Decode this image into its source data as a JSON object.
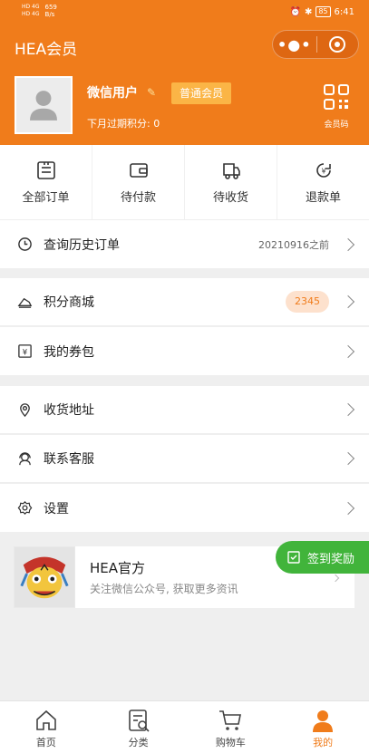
{
  "status_bar": {
    "network_1": "HD 4G",
    "network_2": "HD 4G",
    "speed_value": "659",
    "speed_unit": "B/s",
    "battery": "85",
    "time": "6:41"
  },
  "nav": {
    "title": "HEA会员",
    "more_glyph": "•●•"
  },
  "profile": {
    "username": "微信用户",
    "badge": "普通会员",
    "points_label": "下月过期积分: 0",
    "qr_label": "会员码"
  },
  "orders": [
    {
      "label": "全部订单",
      "icon": "order-list-icon"
    },
    {
      "label": "待付款",
      "icon": "wallet-icon"
    },
    {
      "label": "待收货",
      "icon": "delivery-truck-icon"
    },
    {
      "label": "退款单",
      "icon": "refund-icon"
    }
  ],
  "history": {
    "label": "查询历史订单",
    "date": "20210916之前"
  },
  "mall": {
    "label": "积分商城",
    "points": "2345"
  },
  "coupons": {
    "label": "我的券包"
  },
  "address": {
    "label": "收货地址"
  },
  "service": {
    "label": "联系客服"
  },
  "settings": {
    "label": "设置"
  },
  "official": {
    "name": "HEA官方",
    "desc": "关注微信公众号, 获取更多资讯"
  },
  "checkin": {
    "label": "签到奖励"
  },
  "tabs": [
    {
      "label": "首页",
      "icon": "home-icon"
    },
    {
      "label": "分类",
      "icon": "category-icon"
    },
    {
      "label": "购物车",
      "icon": "cart-icon"
    },
    {
      "label": "我的",
      "icon": "user-icon"
    }
  ],
  "colors": {
    "brand": "#f07c1b",
    "badge": "#fbb546",
    "checkin": "#41b43b",
    "pill_bg": "#fde1cd"
  }
}
